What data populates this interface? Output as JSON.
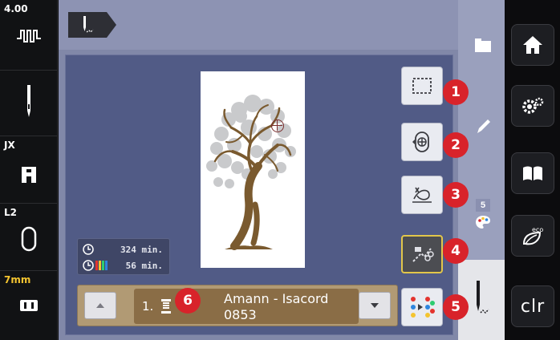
{
  "left_bar": {
    "stitch_width": "4.00",
    "presser_foot": "JX",
    "stitch_plate": "L2",
    "hoop_size": "7mm"
  },
  "tools": [
    {
      "id": "move-hoop",
      "badge": "1"
    },
    {
      "id": "check-size",
      "badge": "2"
    },
    {
      "id": "move-needle",
      "badge": "3"
    },
    {
      "id": "thread-cutting",
      "badge": "4"
    },
    {
      "id": "color-resequence",
      "badge": "5"
    }
  ],
  "times": {
    "total": "324 min.",
    "remaining": "56 min."
  },
  "thread": {
    "color_index": "1.",
    "badge": "6",
    "brand": "Amann - Isacord",
    "number": "0853"
  },
  "side": {
    "color_count": "5"
  },
  "right_bar": {
    "clr_label": "clr"
  },
  "colors": {
    "accent_red": "#d8232a",
    "active_border": "#e2c64a",
    "tree_trunk": "#7a5a2f"
  }
}
